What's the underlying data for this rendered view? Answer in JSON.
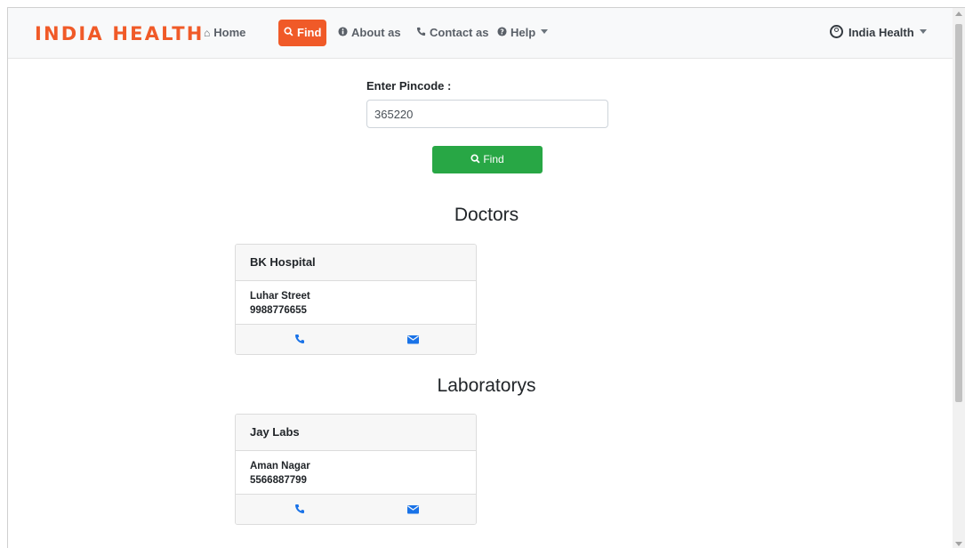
{
  "nav": {
    "brand": "INDIA HEALTH",
    "items": [
      {
        "label": "Home",
        "icon": "home-icon"
      },
      {
        "label": "Find",
        "icon": "search-icon",
        "active": true
      },
      {
        "label": "About as",
        "icon": "info-icon"
      },
      {
        "label": "Contact as",
        "icon": "phone-icon"
      },
      {
        "label": "Help",
        "icon": "question-icon",
        "dropdown": true
      }
    ],
    "user": {
      "label": "India Health",
      "icon": "user-circle-icon",
      "dropdown": true
    }
  },
  "search": {
    "label": "Enter Pincode :",
    "value": "365220",
    "button_label": "Find"
  },
  "sections": {
    "doctors": {
      "title": "Doctors",
      "cards": [
        {
          "name": "BK Hospital",
          "address": "Luhar Street",
          "phone": "9988776655"
        }
      ]
    },
    "laboratories": {
      "title": "Laboratorys",
      "cards": [
        {
          "name": "Jay Labs",
          "address": "Aman Nagar",
          "phone": "5566887799"
        }
      ]
    }
  },
  "colors": {
    "brand": "#f05a28",
    "find_button": "#28a745",
    "card_icon": "#1a73e8"
  }
}
